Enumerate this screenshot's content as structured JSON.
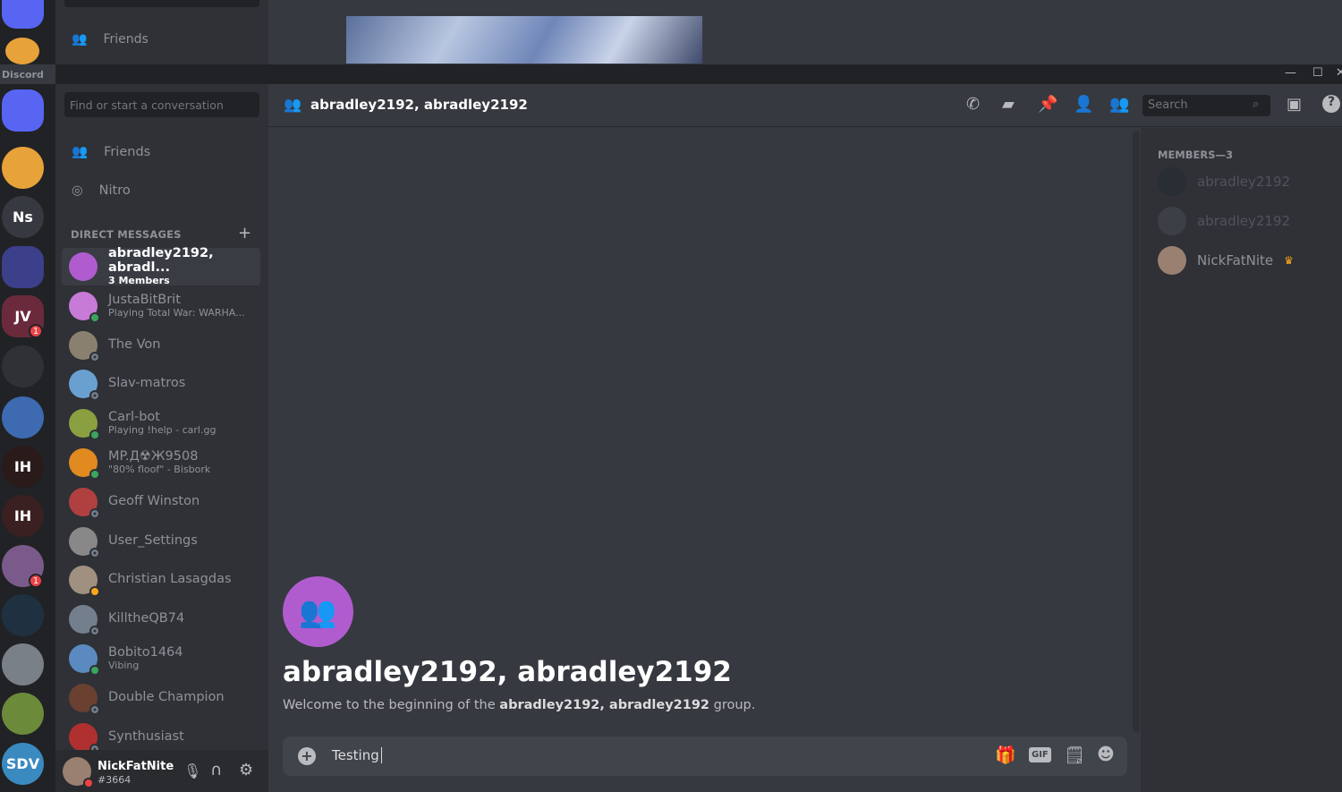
{
  "background_window": {
    "sidebar_item": "Friends",
    "taskbar_label": "Discord"
  },
  "window_controls": {
    "minimize": "—",
    "maximize": "☐",
    "close": "✕"
  },
  "servers": [
    {
      "label": "",
      "icon": "discord-home-icon",
      "color": "#5865f2"
    },
    {
      "label": "",
      "icon": "nick-fat-nite-server-icon",
      "color": "#e8a23a"
    },
    {
      "label": "Ns",
      "color": "#36393f"
    },
    {
      "label": "",
      "icon": "server-folder-icon",
      "color": "#3c3f8a"
    },
    {
      "label": "JV",
      "icon": "server-folder-icon",
      "color": "#6b2a3c",
      "badge": "1"
    },
    {
      "label": "",
      "icon": "folder-icon",
      "color": "#2f3136"
    },
    {
      "label": "",
      "icon": "gold-server-icon",
      "color": "#3d6ab0"
    },
    {
      "label": "IH",
      "color": "#2a1a1a"
    },
    {
      "label": "IH",
      "color": "#3a2020"
    },
    {
      "label": "",
      "icon": "city-server-icon",
      "color": "#7a5a8a",
      "badge": "1"
    },
    {
      "label": "",
      "icon": "swoosh-server-icon",
      "color": "#1f3140"
    },
    {
      "label": "",
      "icon": "shield-server-icon",
      "color": "#7a8088"
    },
    {
      "label": "",
      "icon": "village-server-icon",
      "color": "#6b8a3a"
    },
    {
      "label": "SDV",
      "color": "#3a8ac0"
    }
  ],
  "sidebar": {
    "search_placeholder": "Find or start a conversation",
    "nav": [
      {
        "label": "Friends",
        "icon": "friends-icon"
      },
      {
        "label": "Nitro",
        "icon": "nitro-icon"
      }
    ],
    "dm_header": "DIRECT MESSAGES",
    "dm_add": "+",
    "dms": [
      {
        "name": "abradley2192, abradl...",
        "sub": "3 Members",
        "active": true,
        "color": "#b05ccf",
        "status": ""
      },
      {
        "name": "JustaBitBrit",
        "sub": "Playing Total War: WARHA...",
        "color": "#c77ad6",
        "status": "on"
      },
      {
        "name": "The Von",
        "sub": "",
        "color": "#8a8070",
        "status": "off"
      },
      {
        "name": "Slav-matros",
        "sub": "",
        "color": "#6aa0d0",
        "status": "off"
      },
      {
        "name": "Carl-bot",
        "sub": "Playing !help - carl.gg",
        "color": "#8aa040",
        "status": "on"
      },
      {
        "name": "MP.Д☢Ж9508",
        "sub": "\"80% floof\" - Bisbork",
        "color": "#e08a20",
        "status": "on"
      },
      {
        "name": "Geoff Winston",
        "sub": "",
        "color": "#b04040",
        "status": "off"
      },
      {
        "name": "User_Settings",
        "sub": "",
        "color": "#888888",
        "status": "off"
      },
      {
        "name": "Christian Lasagdas",
        "sub": "",
        "color": "#a09080",
        "status": "idle"
      },
      {
        "name": "KilltheQB74",
        "sub": "",
        "color": "#747f8d",
        "status": "off"
      },
      {
        "name": "Bobito1464",
        "sub": "Vibing",
        "color": "#5a8ac0",
        "status": "on"
      },
      {
        "name": "Double Champion",
        "sub": "",
        "color": "#6a4030",
        "status": "off"
      },
      {
        "name": "Synthusiast",
        "sub": "",
        "color": "#b03030",
        "status": "off"
      }
    ]
  },
  "user_panel": {
    "name": "NickFatNite",
    "tag": "#3664",
    "status": "dnd"
  },
  "header": {
    "title": "abradley2192, abradley2192",
    "search_placeholder": "Search",
    "icons": [
      "start-voice-call-icon",
      "start-video-call-icon",
      "pinned-messages-icon",
      "add-friends-to-dm-icon",
      "member-list-icon",
      "inbox-icon",
      "help-icon"
    ]
  },
  "members": {
    "header": "MEMBERS—3",
    "list": [
      {
        "name": "abradley2192",
        "offline": true,
        "color": "#1e2a30"
      },
      {
        "name": "abradley2192",
        "offline": true,
        "color": "#4f545c"
      },
      {
        "name": "NickFatNite",
        "offline": false,
        "owner": true,
        "color": "#9a8070"
      }
    ]
  },
  "chat": {
    "title": "abradley2192, abradley2192",
    "welcome_prefix": "Welcome to the beginning of the ",
    "welcome_group": "abradley2192, abradley2192",
    "welcome_suffix": " group.",
    "composer_value": "Testing",
    "composer_icons": [
      "attach-plus-icon",
      "gift-icon",
      "gif-icon",
      "sticker-icon",
      "emoji-icon"
    ],
    "gif_label": "GIF"
  }
}
